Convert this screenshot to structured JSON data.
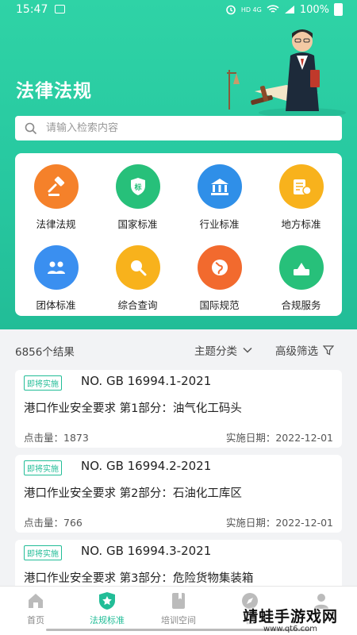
{
  "status_bar": {
    "time": "15:47",
    "indicators": "HD 4G",
    "battery": "100%"
  },
  "header": {
    "title": "法律法规"
  },
  "search": {
    "placeholder": "请输入检索内容"
  },
  "categories": [
    {
      "label": "法律法规",
      "icon": "gavel-icon",
      "color": "#f5812a"
    },
    {
      "label": "国家标准",
      "icon": "shield-standard-icon",
      "color": "#27c07a"
    },
    {
      "label": "行业标准",
      "icon": "building-icon",
      "color": "#2f8fe8"
    },
    {
      "label": "地方标准",
      "icon": "map-pin-icon",
      "color": "#f8b21c"
    },
    {
      "label": "团体标准",
      "icon": "group-icon",
      "color": "#3a8ff0"
    },
    {
      "label": "综合查询",
      "icon": "magnifier-icon",
      "color": "#f8b21c"
    },
    {
      "label": "国际规范",
      "icon": "globe-icon",
      "color": "#f26a2e"
    },
    {
      "label": "合规服务",
      "icon": "service-box-icon",
      "color": "#27c07a"
    }
  ],
  "results": {
    "count": "6856个结果",
    "filter_topic": "主题分类",
    "filter_advanced": "高级筛选"
  },
  "items": [
    {
      "badge": "即将实施",
      "number": "NO. GB 16994.1-2021",
      "title": "港口作业安全要求 第1部分：油气化工码头",
      "clicks": "点击量：1873",
      "date": "实施日期：2022-12-01"
    },
    {
      "badge": "即将实施",
      "number": "NO. GB 16994.2-2021",
      "title": "港口作业安全要求 第2部分：石油化工库区",
      "clicks": "点击量：766",
      "date": "实施日期：2022-12-01"
    },
    {
      "badge": "即将实施",
      "number": "NO. GB 16994.3-2021",
      "title": "港口作业安全要求 第3部分：危险货物集装箱",
      "clicks": "",
      "date": ""
    }
  ],
  "tabs": [
    {
      "label": "首页",
      "icon": "home-icon"
    },
    {
      "label": "法规标准",
      "icon": "star-shield-icon",
      "active": true
    },
    {
      "label": "培训空间",
      "icon": "book-icon"
    },
    {
      "label": "信",
      "icon": "compass-icon"
    },
    {
      "label": "",
      "icon": "user-icon"
    }
  ],
  "watermark": {
    "line1": "靖蛙手游戏网",
    "line2": "www.qt6.com"
  },
  "colors": {
    "brand": "#22bd97",
    "hero_top": "#2fd3a6"
  }
}
